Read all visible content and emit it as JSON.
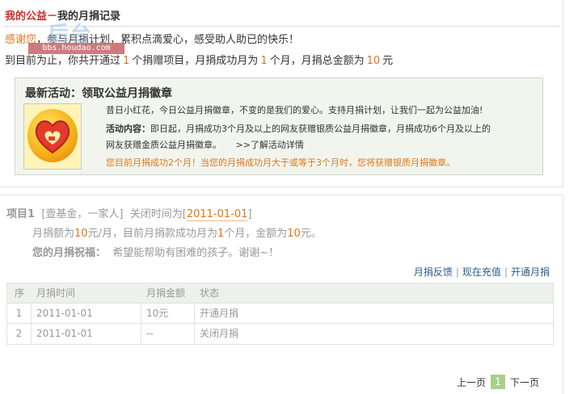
{
  "header": {
    "title_main": "我的公益",
    "title_sep": "－",
    "title_sub": "我的月捐记录"
  },
  "watermark": {
    "logo_text": "后台",
    "url": "bbs.houdao.com"
  },
  "intro": {
    "greeting": "感谢您",
    "greeting_rest": "，参与月捐计划，累积点滴爱心，感受助人助已的快乐！",
    "summary_prefix": "到目前为止，你共开通过",
    "projects_count": "1",
    "summary_mid1": "个捐赠项目，月捐成功月为",
    "success_months": "1",
    "summary_mid2": "个月，月捐总金额为",
    "total_amount": "10",
    "summary_unit": "元"
  },
  "activity": {
    "title": "最新活动：领取公益月捐徽章",
    "line1": "昔日小红花，今日公益月捐徽章，不变的是我们的爱心。支持月捐计划，让我们一起为公益加油!",
    "content_label": "活动内容：",
    "content_text": "即日起，月捐成功3个月及以上的网友获赠银质公益月捐徽章，月捐成功6个月及以上的",
    "content_text2": "网友获赠金质公益月捐徽章。",
    "more_link": ">>了解活动详情",
    "status_text": "您目前月捐成功2个月！当您的月捐成功月大于或等于3个月时，您将获赠银质月捐徽章。"
  },
  "project": {
    "label": "项目1",
    "org": "[壹基金，一家人]",
    "close_label": "关闭时间为[",
    "close_date": "2011-01-01",
    "close_end": "]",
    "amount_prefix": "月捐额为",
    "amount_value": "10",
    "amount_unit": "元/月，目前月捐款成功月为",
    "months_value": "1",
    "months_mid": "个月，金额为",
    "total_value": "10",
    "total_unit": "元。",
    "wish_label": "您的月捐祝福：",
    "wish_text": "希望能帮助有困难的孩子。谢谢~！"
  },
  "links": {
    "feedback": "月捐反馈",
    "recharge": "现在充值",
    "open": "开通月捐",
    "sep": "|"
  },
  "table": {
    "headers": [
      "序",
      "月捐时间",
      "月捐金额",
      "状态"
    ],
    "rows": [
      [
        "1",
        "2011-01-01",
        "10元",
        "开通月捐"
      ],
      [
        "2",
        "2011-01-01",
        "--",
        "关闭月捐"
      ]
    ]
  },
  "pager": {
    "prev": "上一页",
    "current": "1",
    "next": "下一页"
  },
  "colors": {
    "accent_orange": "#e0761a",
    "title_red": "#c9302c",
    "link_blue": "#2c5a8c",
    "pager_green": "#a8d08d"
  }
}
